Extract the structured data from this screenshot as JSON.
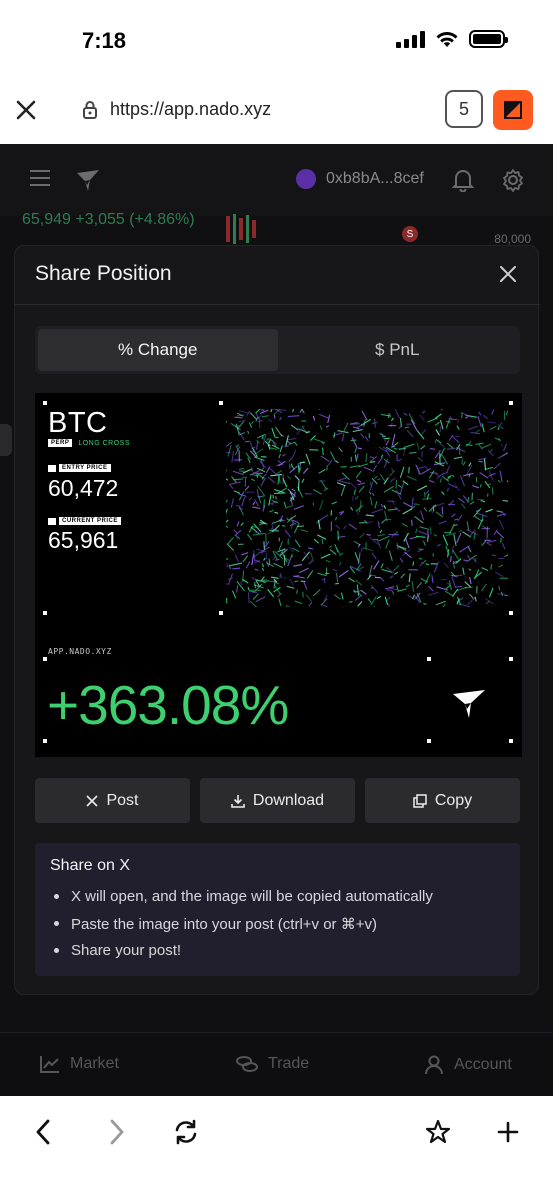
{
  "status_bar": {
    "time": "7:18"
  },
  "browser": {
    "url": "https://app.nado.xyz",
    "tab_count": "5"
  },
  "app": {
    "wallet_address": "0xb8bA...8cef",
    "ticker_text": "65,949 +3,055 (+4.86%)",
    "axis_label": "80,000",
    "signal_badge": "S",
    "nav": {
      "market": "Market",
      "trade": "Trade",
      "account": "Account"
    }
  },
  "modal": {
    "title": "Share Position",
    "tabs": [
      {
        "label": "% Change",
        "active": true
      },
      {
        "label": "$ PnL",
        "active": false
      }
    ],
    "card": {
      "symbol": "BTC",
      "market_type": "PERP",
      "side_tag": "LONG CROSS",
      "entry_label": "ENTRY PRICE",
      "entry_price": "60,472",
      "current_label": "CURRENT PRICE",
      "current_price": "65,961",
      "app_url": "APP.NADO.XYZ",
      "change_percent": "+363.08%"
    },
    "actions": {
      "post": "Post",
      "download": "Download",
      "copy": "Copy"
    },
    "share_info": {
      "heading": "Share on X",
      "steps": [
        "X will open, and the image will be copied automatically",
        "Paste the image into your post (ctrl+v or ⌘+v)",
        "Share your post!"
      ]
    }
  },
  "colors": {
    "accent_green": "#3ecf6f",
    "modal_bg": "#17171a",
    "info_bg": "#211f2e",
    "browser_ext": "#ff5a1f"
  }
}
